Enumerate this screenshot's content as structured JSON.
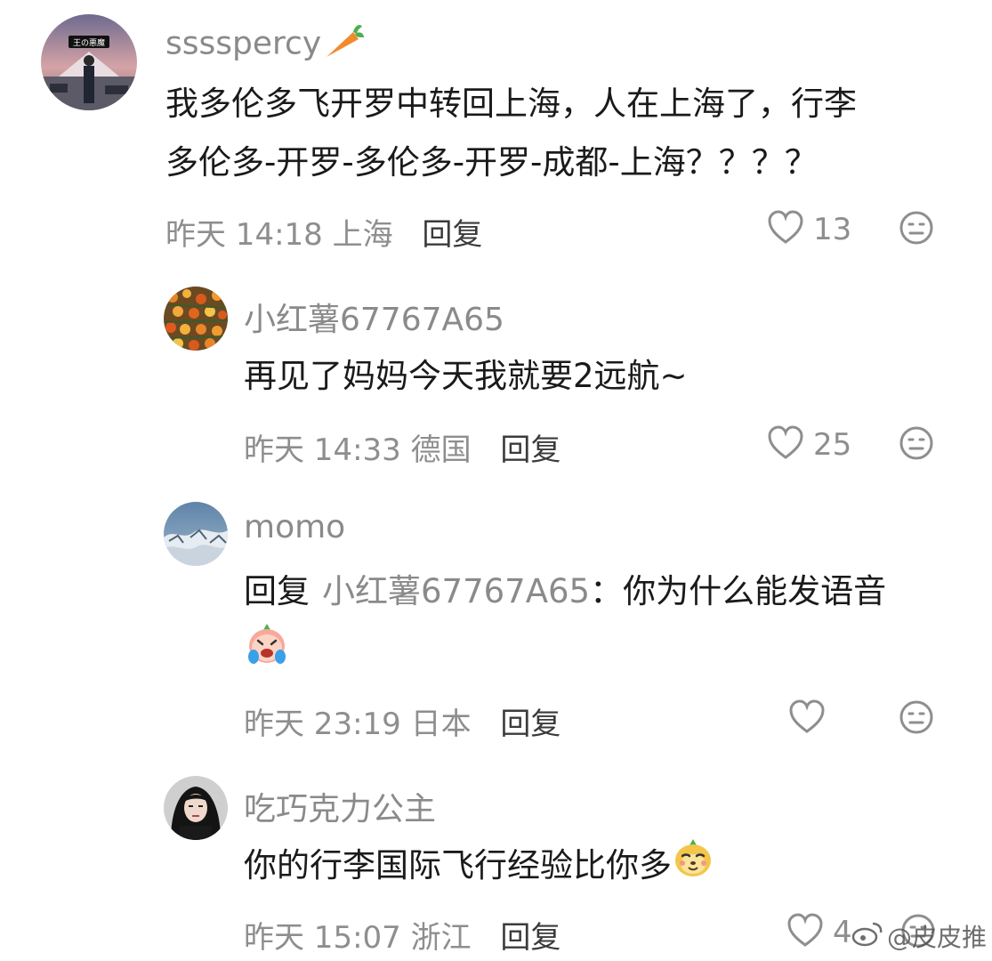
{
  "comments": [
    {
      "username": "sssspercy",
      "avatar_label": "王の悪魔",
      "lines": [
        "我多伦多飞开罗中转回上海，人在上海了，行李",
        "多伦多-开罗-多伦多-开罗-成都-上海？？？？"
      ],
      "time": "昨天 14:18",
      "location": "上海",
      "reply_label": "回复",
      "likes": "13"
    },
    {
      "username": "小红薯67767A65",
      "lines": [
        "再见了妈妈今天我就要2远航~"
      ],
      "time": "昨天 14:33",
      "location": "德国",
      "reply_label": "回复",
      "likes": "25"
    },
    {
      "username": "momo",
      "reply_word": "回复",
      "reply_target": "小红薯67767A65",
      "reply_text": "：你为什么能发语音",
      "time": "昨天 23:19",
      "location": "日本",
      "reply_label": "回复",
      "likes": ""
    },
    {
      "username": "吃巧克力公主",
      "lines": [
        "你的行李国际飞行经验比你多"
      ],
      "time": "昨天 15:07",
      "location": "浙江",
      "reply_label": "回复",
      "likes": "4"
    }
  ],
  "watermark": "@皮皮推",
  "colors": {
    "meta_gray": "#8e8e8e",
    "username_gray": "#8a8a8a",
    "text": "#1a1a1a",
    "carrot_orange": "#f28a2e",
    "carrot_green": "#4caf50"
  },
  "icons": [
    "carrot-icon",
    "heart-icon",
    "dislike-face-icon",
    "crying-emoji",
    "smug-emoji",
    "weibo-icon"
  ]
}
